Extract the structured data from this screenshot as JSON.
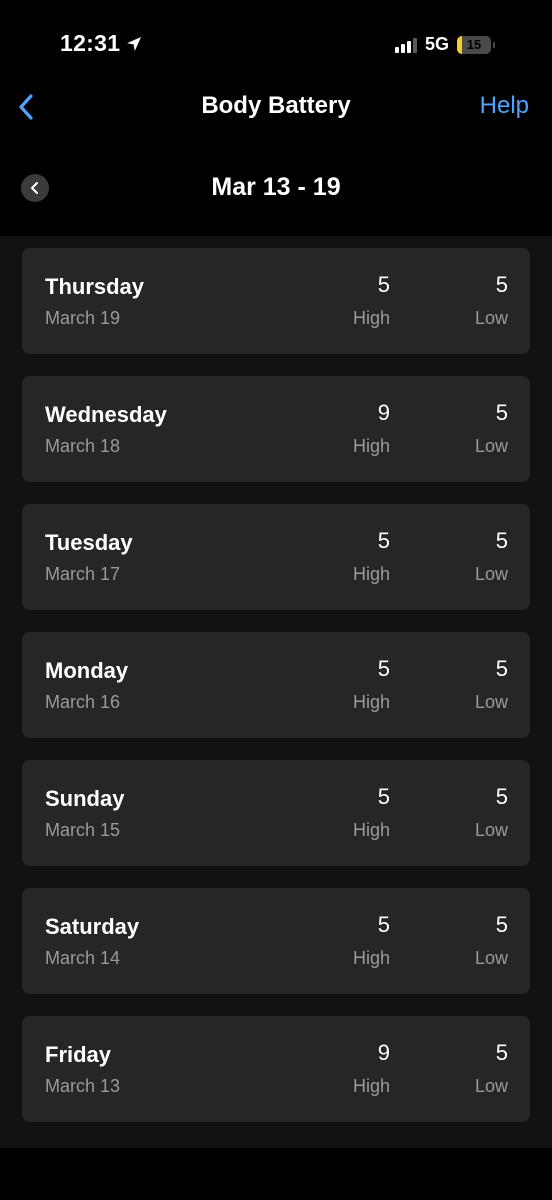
{
  "status_bar": {
    "time": "12:31",
    "network": "5G",
    "battery_level": "15",
    "battery_fraction": 0.15,
    "location_icon": "location-arrow-icon",
    "signal_icon": "cellular-signal-icon"
  },
  "header": {
    "title": "Body Battery",
    "help_label": "Help",
    "back_icon": "chevron-left-icon"
  },
  "range": {
    "title": "Mar 13 - 19",
    "prev_icon": "chevron-left-icon"
  },
  "colors": {
    "accent": "#4da3ff",
    "card": "#262626",
    "battery_low": "#f5cc2e"
  },
  "days": [
    {
      "day": "Thursday",
      "date": "March 19",
      "high": "5",
      "high_label": "High",
      "low": "5",
      "low_label": "Low"
    },
    {
      "day": "Wednesday",
      "date": "March 18",
      "high": "9",
      "high_label": "High",
      "low": "5",
      "low_label": "Low"
    },
    {
      "day": "Tuesday",
      "date": "March 17",
      "high": "5",
      "high_label": "High",
      "low": "5",
      "low_label": "Low"
    },
    {
      "day": "Monday",
      "date": "March 16",
      "high": "5",
      "high_label": "High",
      "low": "5",
      "low_label": "Low"
    },
    {
      "day": "Sunday",
      "date": "March 15",
      "high": "5",
      "high_label": "High",
      "low": "5",
      "low_label": "Low"
    },
    {
      "day": "Saturday",
      "date": "March 14",
      "high": "5",
      "high_label": "High",
      "low": "5",
      "low_label": "Low"
    },
    {
      "day": "Friday",
      "date": "March 13",
      "high": "9",
      "high_label": "High",
      "low": "5",
      "low_label": "Low"
    }
  ]
}
